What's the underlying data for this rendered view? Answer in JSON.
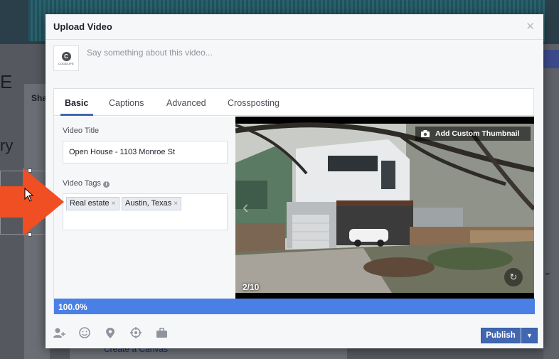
{
  "background": {
    "big_letter": "E",
    "word": "ry",
    "card_label": "Sha",
    "bottom_link": "Create a Canvas"
  },
  "modal": {
    "title": "Upload Video",
    "close_icon": "close-icon",
    "composer": {
      "avatar_letter": "C",
      "avatar_text": "COODLIFE",
      "placeholder": "Say something about this video..."
    },
    "tabs": [
      "Basic",
      "Captions",
      "Advanced",
      "Crossposting"
    ],
    "active_tab": "Basic",
    "video_title_label": "Video Title",
    "video_title_value": "Open House - 1103 Monroe St",
    "video_tags_label": "Video Tags",
    "tags": [
      {
        "label": "Real estate",
        "remove": "×"
      },
      {
        "label": "Austin, Texas",
        "remove": "×"
      }
    ],
    "thumbnail_button": "Add Custom Thumbnail",
    "thumbnail_counter": "2/10",
    "progress_text": "100.0%",
    "progress": 1.0,
    "footer_icons": [
      "tag-people-icon",
      "feeling-icon",
      "location-icon",
      "target-icon",
      "briefcase-icon"
    ],
    "publish_label": "Publish"
  },
  "colors": {
    "accent": "#4267b2",
    "progress": "#4a7fe6",
    "arrow": "#f04e23"
  }
}
